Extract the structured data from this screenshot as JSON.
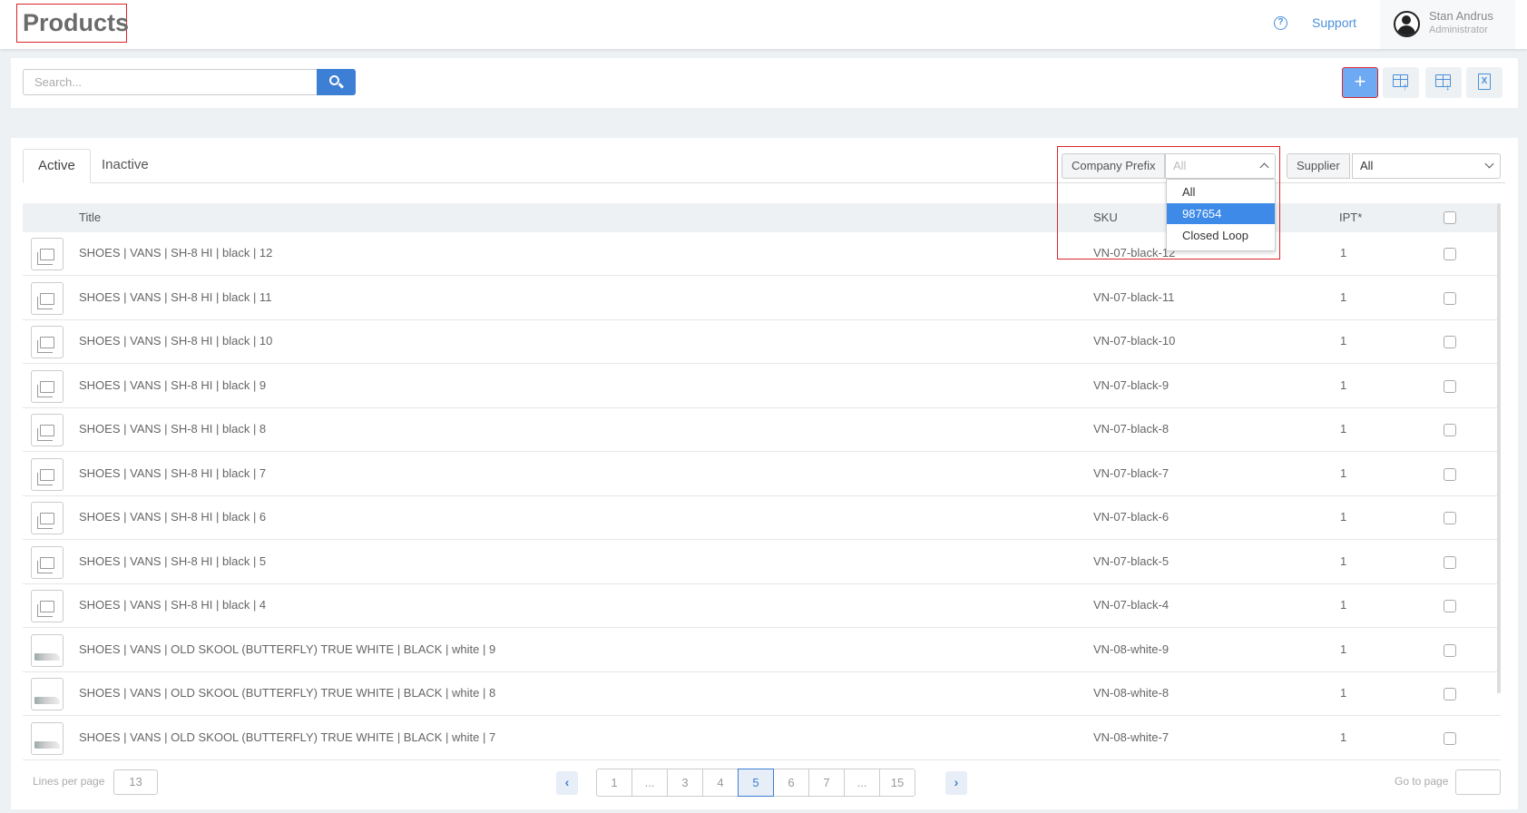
{
  "header": {
    "title": "Products",
    "support_label": "Support",
    "user_name": "Stan Andrus",
    "user_role": "Administrator"
  },
  "toolbar": {
    "search_placeholder": "Search...",
    "add_label": "+"
  },
  "tabs": [
    {
      "label": "Active",
      "active": true
    },
    {
      "label": "Inactive",
      "active": false
    }
  ],
  "filters": {
    "company_prefix": {
      "label": "Company Prefix",
      "value": "All",
      "options": [
        "All",
        "987654",
        "Closed Loop"
      ],
      "highlighted": "987654"
    },
    "supplier": {
      "label": "Supplier",
      "value": "All"
    }
  },
  "table": {
    "columns": [
      "Title",
      "SKU",
      "IPT*"
    ],
    "rows": [
      {
        "thumb": "placeholder",
        "title": "SHOES | VANS | SH-8 HI | black | 12",
        "sku": "VN-07-black-12",
        "ipt": "1"
      },
      {
        "thumb": "placeholder",
        "title": "SHOES | VANS | SH-8 HI | black | 11",
        "sku": "VN-07-black-11",
        "ipt": "1"
      },
      {
        "thumb": "placeholder",
        "title": "SHOES | VANS | SH-8 HI | black | 10",
        "sku": "VN-07-black-10",
        "ipt": "1"
      },
      {
        "thumb": "placeholder",
        "title": "SHOES | VANS | SH-8 HI | black | 9",
        "sku": "VN-07-black-9",
        "ipt": "1"
      },
      {
        "thumb": "placeholder",
        "title": "SHOES | VANS | SH-8 HI | black | 8",
        "sku": "VN-07-black-8",
        "ipt": "1"
      },
      {
        "thumb": "placeholder",
        "title": "SHOES | VANS | SH-8 HI | black | 7",
        "sku": "VN-07-black-7",
        "ipt": "1"
      },
      {
        "thumb": "placeholder",
        "title": "SHOES | VANS | SH-8 HI | black | 6",
        "sku": "VN-07-black-6",
        "ipt": "1"
      },
      {
        "thumb": "placeholder",
        "title": "SHOES | VANS | SH-8 HI | black | 5",
        "sku": "VN-07-black-5",
        "ipt": "1"
      },
      {
        "thumb": "placeholder",
        "title": "SHOES | VANS | SH-8 HI | black | 4",
        "sku": "VN-07-black-4",
        "ipt": "1"
      },
      {
        "thumb": "shoe",
        "title": "SHOES | VANS | OLD SKOOL (BUTTERFLY) TRUE WHITE | BLACK | white | 9",
        "sku": "VN-08-white-9",
        "ipt": "1"
      },
      {
        "thumb": "shoe",
        "title": "SHOES | VANS | OLD SKOOL (BUTTERFLY) TRUE WHITE | BLACK | white | 8",
        "sku": "VN-08-white-8",
        "ipt": "1"
      },
      {
        "thumb": "shoe",
        "title": "SHOES | VANS | OLD SKOOL (BUTTERFLY) TRUE WHITE | BLACK | white | 7",
        "sku": "VN-08-white-7",
        "ipt": "1"
      }
    ]
  },
  "pagination": {
    "lines_label": "Lines per page",
    "lines_value": "13",
    "pages": [
      "1",
      "...",
      "3",
      "4",
      "5",
      "6",
      "7",
      "...",
      "15"
    ],
    "current": "5",
    "goto_label": "Go to page"
  },
  "colors": {
    "accent": "#3d7fd4",
    "highlight_border": "#d9262c",
    "selected_option": "#3d8ae8"
  }
}
